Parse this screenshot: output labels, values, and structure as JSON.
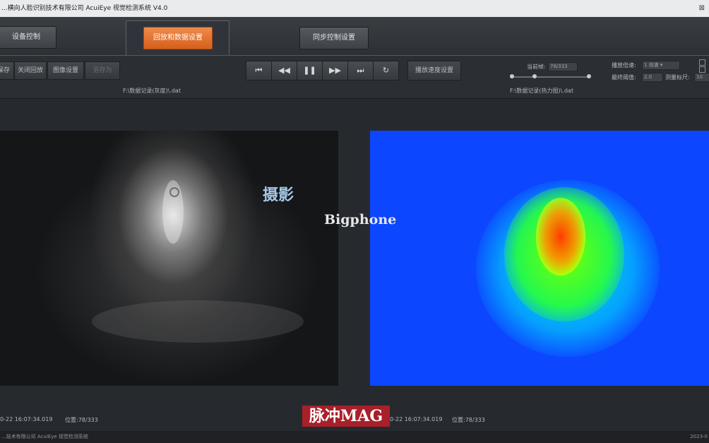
{
  "window": {
    "title": "...横向人脸识别技术有限公司 AcuiEye 视觉检测系统 V4.0",
    "close_glyph": "⊠"
  },
  "tabs": [
    {
      "label": "设备控制",
      "active": false
    },
    {
      "label": "回放和数据设置",
      "active": true
    },
    {
      "label": "同步控制设置",
      "active": false
    }
  ],
  "toolbar": {
    "left_buttons": [
      "保存",
      "关闭回放",
      "图像设置",
      "另存为"
    ],
    "transport": [
      "⏮",
      "◀◀",
      "❚❚",
      "▶▶",
      "⏭",
      "↻"
    ],
    "sync_button": "播放速度设置",
    "frame_label": "当前帧:",
    "frame_value": "78/333",
    "speed_label": "播放倍速:",
    "speed_value": "1 倍速 ▾",
    "threshold_label": "最终阈值:",
    "threshold_value": "2.0",
    "filter_label": "测量标尺:",
    "filter_value": "10"
  },
  "paths": {
    "left": "F:\\数据记录(灰度)\\.dat",
    "right": "F:\\数据记录(热力图)\\.dat"
  },
  "status": {
    "left_time": "0-22 16:07:34.019",
    "left_position": "位置:78/333",
    "right_time": "0-22 16:07:34.019",
    "right_position": "位置:78/333"
  },
  "footer": {
    "left": "...技术有限公司 AcuiEye 视觉检测系统",
    "right": "2023-0"
  },
  "watermarks": {
    "overlay_text": "摄影",
    "center_text": "Bigphone",
    "stamp_text": "脉冲MAG"
  },
  "colors": {
    "accent_tab": "#e3722f",
    "heatmap_background": "#0c46ff"
  },
  "icons": {
    "transport": [
      "skip-start-icon",
      "rewind-icon",
      "pause-icon",
      "fast-forward-icon",
      "skip-end-icon",
      "loop-icon"
    ]
  }
}
